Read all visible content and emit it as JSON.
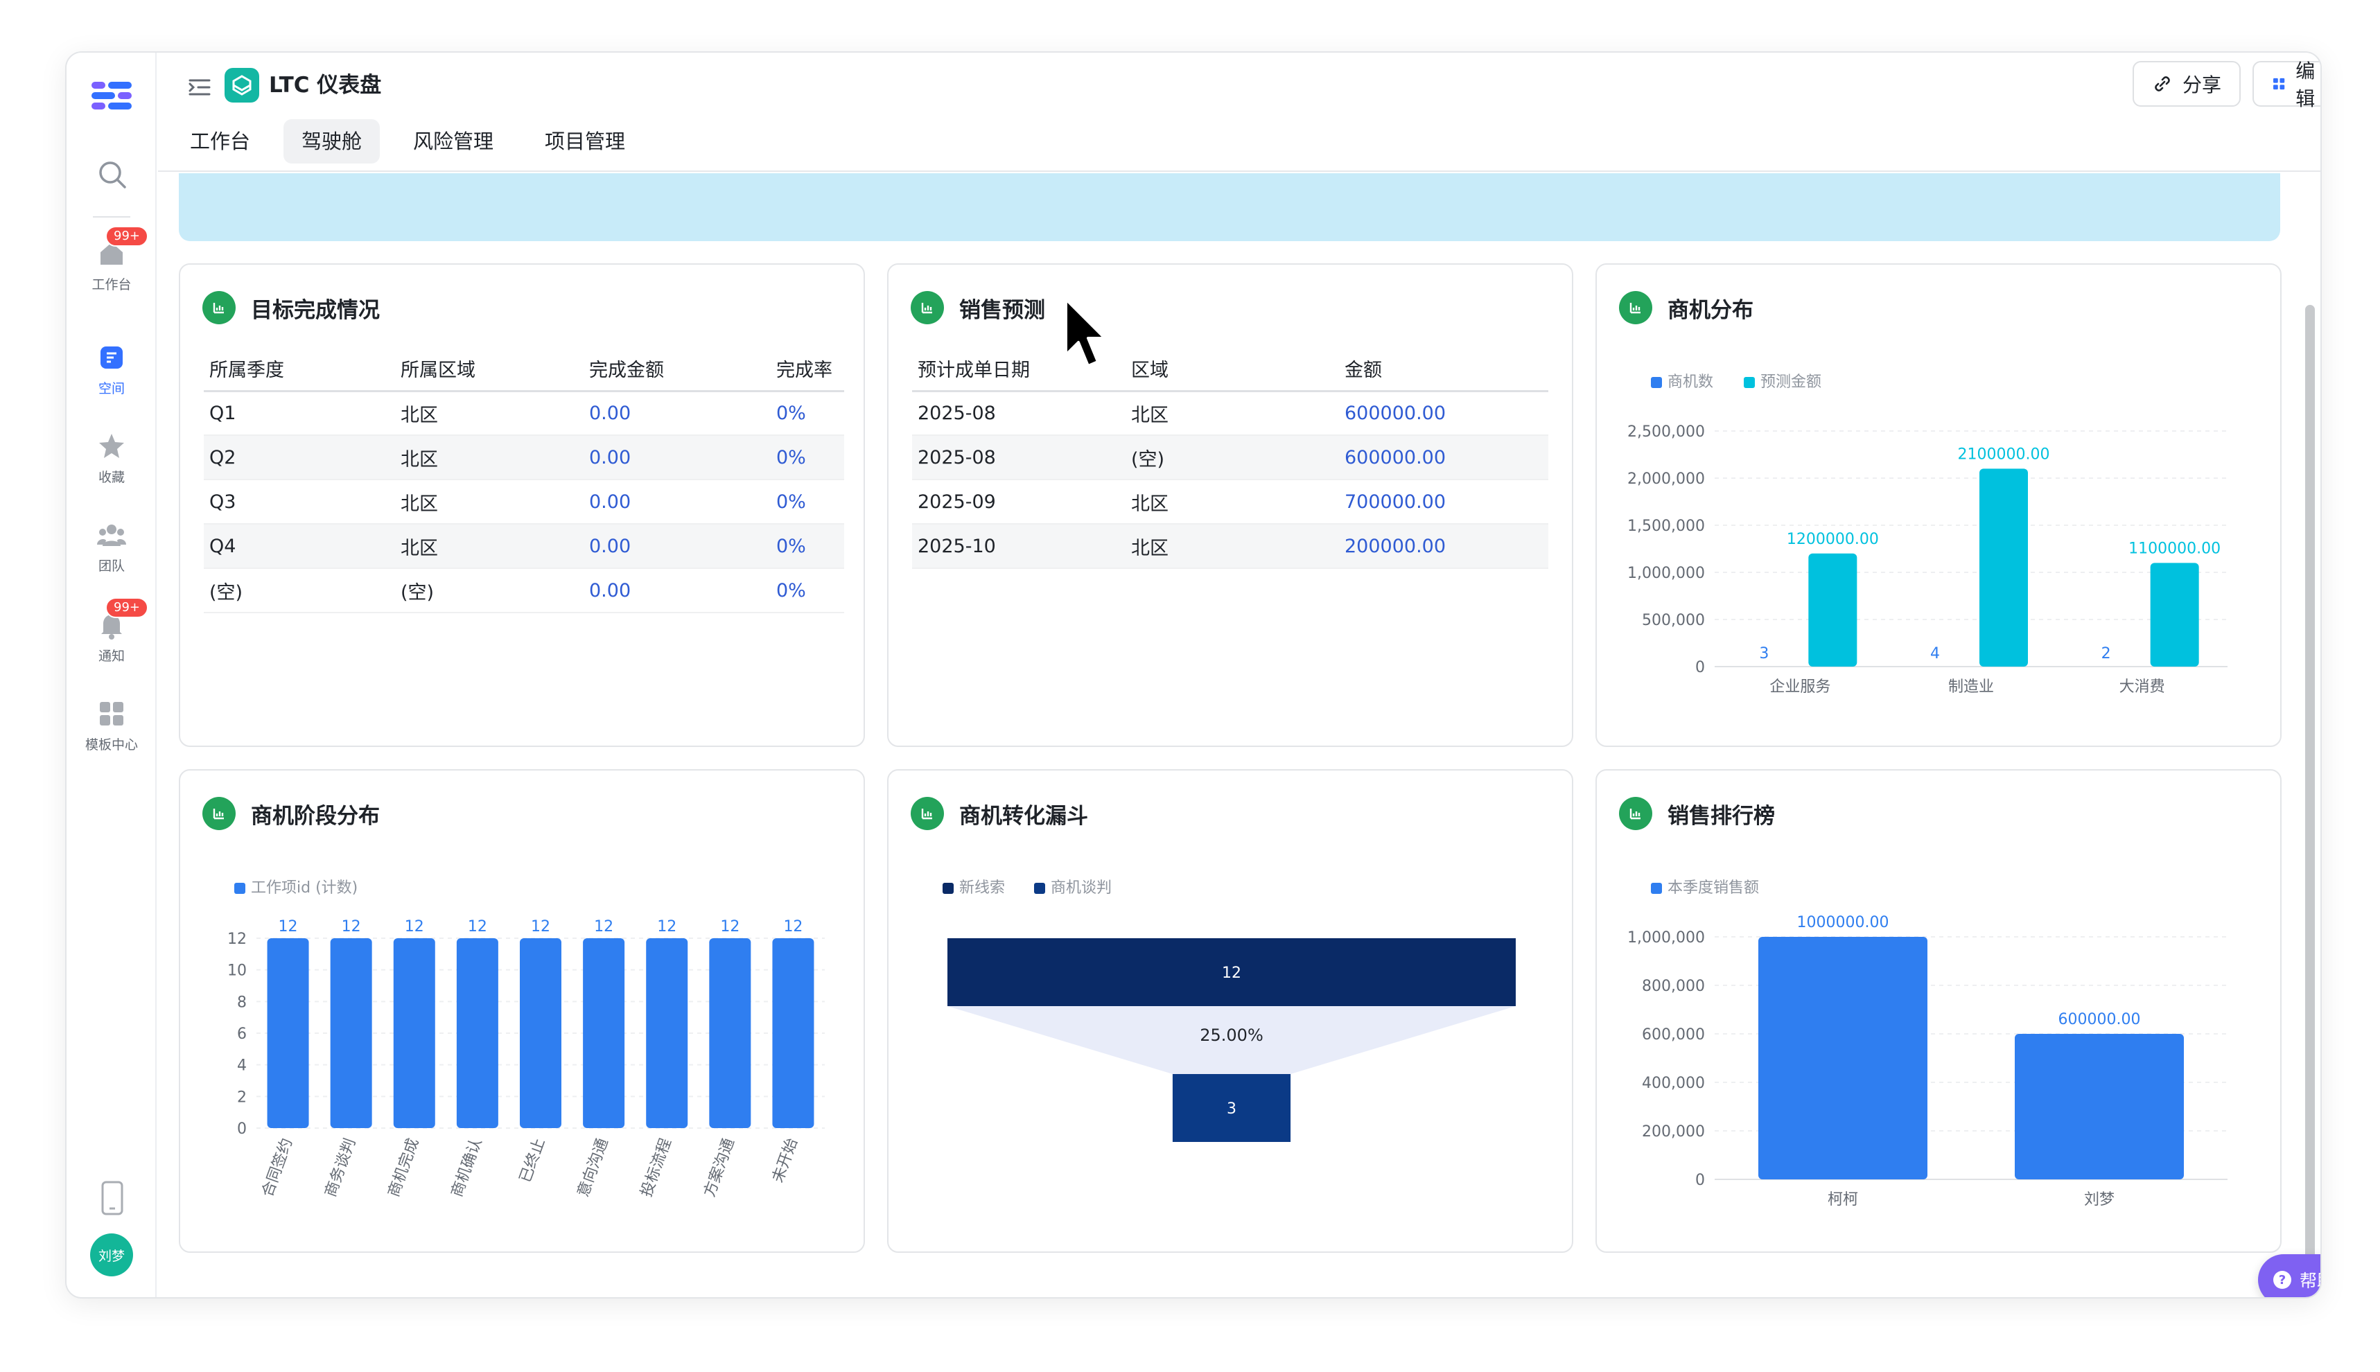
{
  "app": {
    "title": "LTC 仪表盘"
  },
  "header": {
    "tabs": [
      "工作台",
      "驾驶舱",
      "风险管理",
      "项目管理"
    ],
    "active_tab": "驾驶舱",
    "share_label": "分享",
    "edit_label": "编辑"
  },
  "sidebar": {
    "items": [
      {
        "label": "工作台",
        "badge": "99+"
      },
      {
        "label": "空间"
      },
      {
        "label": "收藏"
      },
      {
        "label": "团队"
      },
      {
        "label": "通知",
        "badge": "99+"
      },
      {
        "label": "模板中心"
      }
    ],
    "avatar": "刘梦"
  },
  "cards": {
    "target": {
      "title": "目标完成情况",
      "columns": [
        "所属季度",
        "所属区域",
        "完成金额",
        "完成率"
      ],
      "rows": [
        [
          "Q1",
          "北区",
          "0.00",
          "0%"
        ],
        [
          "Q2",
          "北区",
          "0.00",
          "0%"
        ],
        [
          "Q3",
          "北区",
          "0.00",
          "0%"
        ],
        [
          "Q4",
          "北区",
          "0.00",
          "0%"
        ],
        [
          "(空)",
          "(空)",
          "0.00",
          "0%"
        ]
      ]
    },
    "forecast": {
      "title": "销售预测",
      "columns": [
        "预计成单日期",
        "区域",
        "金额"
      ],
      "rows": [
        [
          "2025-08",
          "北区",
          "600000.00"
        ],
        [
          "2025-08",
          "(空)",
          "600000.00"
        ],
        [
          "2025-09",
          "北区",
          "700000.00"
        ],
        [
          "2025-10",
          "北区",
          "200000.00"
        ]
      ]
    },
    "distribution": {
      "title": "商机分布"
    },
    "stage": {
      "title": "商机阶段分布"
    },
    "funnel": {
      "title": "商机转化漏斗"
    },
    "ranking": {
      "title": "销售排行榜"
    }
  },
  "help_label": "帮助",
  "colors": {
    "blue": "#2f7ef0",
    "cyan": "#00c1de",
    "navy": "#0a2a66",
    "navy2": "#0b3a86",
    "green": "#23a35a"
  },
  "chart_data": [
    {
      "id": "distribution",
      "type": "bar",
      "categories": [
        "企业服务",
        "制造业",
        "大消费"
      ],
      "series": [
        {
          "name": "商机数",
          "values": [
            3,
            4,
            2
          ]
        },
        {
          "name": "预测金额",
          "values": [
            1200000,
            2100000,
            1100000
          ]
        }
      ],
      "value_labels": {
        "商机数": [
          "3",
          "4",
          "2"
        ],
        "预测金额": [
          "1200000.00",
          "2100000.00",
          "1100000.00"
        ]
      },
      "yticks": [
        "0",
        "500,000",
        "1,000,000",
        "1,500,000",
        "2,000,000",
        "2,500,000"
      ],
      "ylim": [
        0,
        2500000
      ],
      "legend": "top-left"
    },
    {
      "id": "stage",
      "type": "bar",
      "categories": [
        "合同签约",
        "商务谈判",
        "商机完成",
        "商机确认",
        "已终止",
        "意向沟通",
        "投标流程",
        "方案沟通",
        "未开始"
      ],
      "series": [
        {
          "name": "工作项id (计数)",
          "values": [
            12,
            12,
            12,
            12,
            12,
            12,
            12,
            12,
            12
          ]
        }
      ],
      "yticks": [
        "0",
        "2",
        "4",
        "6",
        "8",
        "10",
        "12"
      ],
      "ylim": [
        0,
        12
      ],
      "legend": "top-left"
    },
    {
      "id": "funnel",
      "type": "funnel",
      "stages": [
        {
          "name": "新线索",
          "value": 12
        },
        {
          "name": "商机谈判",
          "value": 3
        }
      ],
      "conversion": "25.00%",
      "legend": "top-left"
    },
    {
      "id": "ranking",
      "type": "bar",
      "categories": [
        "柯柯",
        "刘梦"
      ],
      "series": [
        {
          "name": "本季度销售额",
          "values": [
            1000000,
            600000
          ]
        }
      ],
      "value_labels": [
        "1000000.00",
        "600000.00"
      ],
      "yticks": [
        "0",
        "200,000",
        "400,000",
        "600,000",
        "800,000",
        "1,000,000"
      ],
      "ylim": [
        0,
        1000000
      ],
      "legend": "top-left"
    }
  ]
}
